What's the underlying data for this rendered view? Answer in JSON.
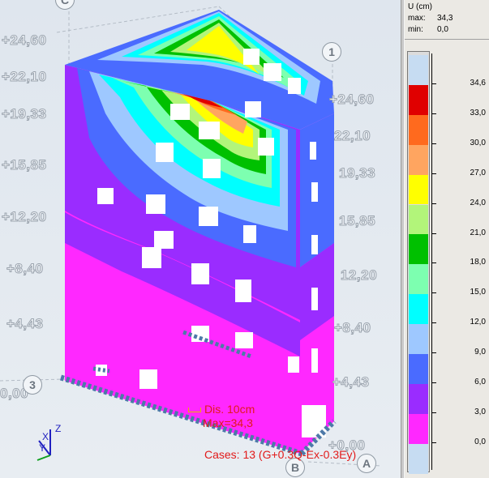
{
  "legend": {
    "quantity_label": "U (cm)",
    "max_label": "max:",
    "max_value": "34,3",
    "min_label": "min:",
    "min_value": "0,0",
    "bands": [
      {
        "color": "#c6dcf2"
      },
      {
        "color": "#e00000"
      },
      {
        "color": "#ff6a1e"
      },
      {
        "color": "#ffa560"
      },
      {
        "color": "#ffff00"
      },
      {
        "color": "#b2f57a"
      },
      {
        "color": "#00c000"
      },
      {
        "color": "#7dffb0"
      },
      {
        "color": "#00ffff"
      },
      {
        "color": "#9ec8ff"
      },
      {
        "color": "#4a6bff"
      },
      {
        "color": "#9a2cff"
      },
      {
        "color": "#ff28ff"
      },
      {
        "color": "#c6dcf2"
      }
    ],
    "tick_values": [
      "34,6",
      "33,0",
      "30,0",
      "27,0",
      "24,0",
      "21,0",
      "18,0",
      "15,0",
      "12,0",
      "9,0",
      "6,0",
      "3,0",
      "0,0"
    ]
  },
  "levels_left": [
    "+24,60",
    "+22,10",
    "+19,33",
    "+15,85",
    "+12,20",
    "+8,40",
    "+4,43",
    "0,00"
  ],
  "levels_right": [
    "+24,60",
    "22,10",
    "19,33",
    "15,85",
    "12,20",
    "+8,40",
    "+4,43",
    "+0,00"
  ],
  "axis_labels": {
    "top_left": "C",
    "top_right": "1",
    "left_middle": "3",
    "bottom_middle": "B",
    "bottom_right": "A"
  },
  "overlay": {
    "dis_line": "Dis. 10cm",
    "max_line": "Max=34,3",
    "cases_line": "Cases: 13 (G+0.3Q-Ex-0.3Ey)"
  },
  "triad": {
    "z": "Z",
    "x": "X",
    "y": "Y"
  },
  "colors": {
    "magenta": "#ff28ff",
    "purple": "#9a2cff",
    "blue": "#4a6bff",
    "text_red": "#e21a1a"
  }
}
